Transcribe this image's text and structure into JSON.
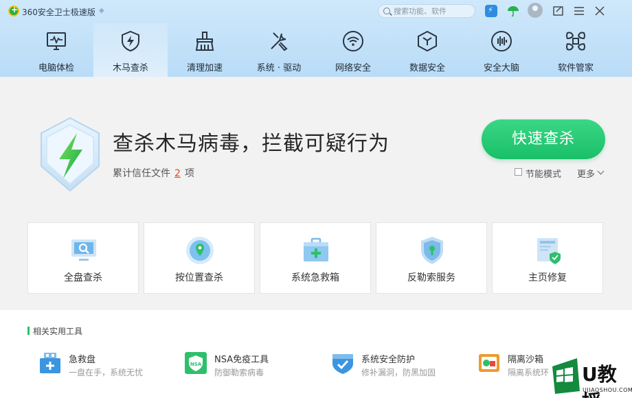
{
  "titlebar": {
    "app_title": "360安全卫士极速版",
    "search_placeholder": "搜索功能、软件"
  },
  "nav": {
    "items": [
      {
        "label": "电脑体检",
        "icon": "monitor-pulse-icon",
        "active": false
      },
      {
        "label": "木马查杀",
        "icon": "shield-bolt-icon",
        "active": true
      },
      {
        "label": "清理加速",
        "icon": "broom-icon",
        "active": false
      },
      {
        "label": "系统 · 驱动",
        "icon": "wrench-screwdriver-icon",
        "active": false
      },
      {
        "label": "网络安全",
        "icon": "wifi-icon",
        "active": false
      },
      {
        "label": "数据安全",
        "icon": "cube-icon",
        "active": false
      },
      {
        "label": "安全大脑",
        "icon": "brain-waveform-icon",
        "active": false
      },
      {
        "label": "软件管家",
        "icon": "apps-grid-icon",
        "active": false
      }
    ]
  },
  "hero": {
    "title": "查杀木马病毒，拦截可疑行为",
    "sub_prefix": "累计信任文件",
    "trust_count": "2",
    "sub_suffix": "项",
    "scan_button": "快速查杀",
    "eco_mode_label": "节能模式",
    "more_label": "更多"
  },
  "cards": [
    {
      "label": "全盘查杀",
      "icon": "monitor-search-icon"
    },
    {
      "label": "按位置查杀",
      "icon": "location-pin-icon"
    },
    {
      "label": "系统急救箱",
      "icon": "first-aid-kit-icon"
    },
    {
      "label": "反勒索服务",
      "icon": "shield-lock-icon"
    },
    {
      "label": "主页修复",
      "icon": "page-shield-icon"
    }
  ],
  "tools": {
    "heading": "相关实用工具",
    "items": [
      {
        "name": "急救盘",
        "desc": "一盘在手，系统无忧",
        "icon": "rescue-drive-icon"
      },
      {
        "name": "NSA免疫工具",
        "desc": "防御勒索病毒",
        "icon": "nsa-shield-icon"
      },
      {
        "name": "系统安全防护",
        "desc": "修补漏洞，防黑加固",
        "icon": "system-shield-icon"
      },
      {
        "name": "隔离沙箱",
        "desc": "隔离系统环",
        "icon": "sandbox-icon"
      }
    ]
  },
  "watermark": {
    "text": "U教授",
    "sub": "UJIAOSHOU.COM"
  },
  "colors": {
    "accent_green": "#1dc36e",
    "header_blue": "#c4e2f9",
    "trust_count_red": "#e0462b"
  }
}
